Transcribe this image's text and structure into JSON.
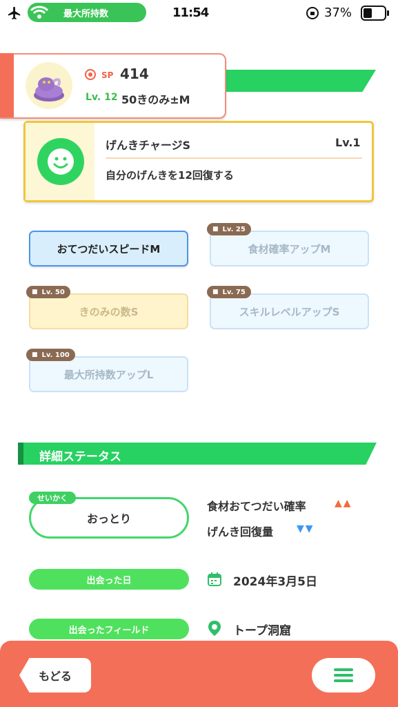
{
  "status_bar": {
    "pill_text": "最大所持数",
    "time": "11:54",
    "battery": "37%"
  },
  "pokemon": {
    "sp_label": "SP",
    "sp_value": "414",
    "level_label": "Lv. 12",
    "berry": "50きのみ±M"
  },
  "main_skill": {
    "name": "げんきチャージS",
    "level": "Lv.1",
    "description": "自分のげんきを12回復する"
  },
  "sub_skills": [
    {
      "label": "おてつだいスピードM",
      "locked": false,
      "unlock": ""
    },
    {
      "label": "食材確率アップM",
      "locked": true,
      "unlock": "Lv. 25"
    },
    {
      "label": "きのみの数S",
      "locked": true,
      "unlock": "Lv. 50"
    },
    {
      "label": "スキルレベルアップS",
      "locked": true,
      "unlock": "Lv. 75"
    },
    {
      "label": "最大所持数アップL",
      "locked": true,
      "unlock": "Lv. 100"
    }
  ],
  "details": {
    "title": "詳細ステータス",
    "nature_tag": "せいかく",
    "nature": "おっとり",
    "nature_up": "食材おてつだい確率",
    "nature_up_mark": "▲▲",
    "nature_down": "げんき回復量",
    "nature_down_mark": "▼▼",
    "met_date_label": "出会った日",
    "met_date": "2024年3月5日",
    "met_field_label": "出会ったフィールド",
    "met_field": "トープ洞窟"
  },
  "bottom": {
    "back_label": "もどる"
  },
  "colors": {
    "accent_green": "#27d162",
    "bottom_orange": "#f46f57",
    "skill_gold": "#f0c53e"
  }
}
